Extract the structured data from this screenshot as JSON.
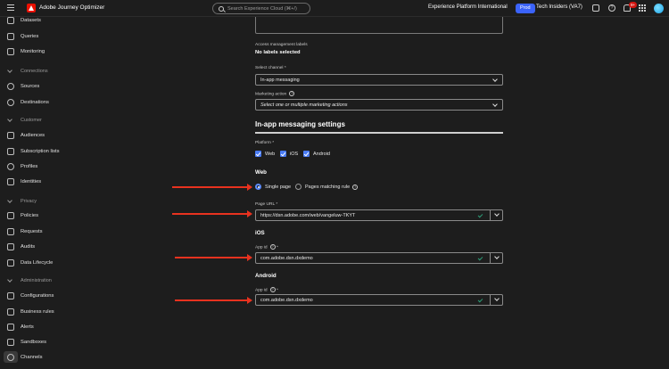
{
  "topbar": {
    "app_name": "Adobe Journey Optimizer",
    "search_placeholder": "Search Experience Cloud (⌘+/)",
    "org_name": "Experience Platform International",
    "env_badge": "Prod",
    "sandbox_name": "Tech Insiders (VA7)",
    "notification_count": "9+",
    "help_glyph": "?"
  },
  "sidebar": {
    "items_top": [
      {
        "label": "Datasets",
        "icon": "dataset-icon"
      },
      {
        "label": "Queries",
        "icon": "queries-icon"
      },
      {
        "label": "Monitoring",
        "icon": "monitoring-icon"
      }
    ],
    "sections": [
      {
        "title": "Connections",
        "items": [
          "Sources",
          "Destinations"
        ]
      },
      {
        "title": "Customer",
        "items": [
          "Audiences",
          "Subscription lists",
          "Profiles",
          "Identities"
        ]
      },
      {
        "title": "Privacy",
        "items": [
          "Policies",
          "Requests",
          "Audits",
          "Data Lifecycle"
        ]
      },
      {
        "title": "Administration",
        "items": [
          "Configurations",
          "Business rules",
          "Alerts",
          "Sandboxes",
          "Channels"
        ]
      }
    ]
  },
  "form": {
    "access_label": "Access management labels",
    "access_value": "No labels selected",
    "channel_label": "Select channel",
    "channel_value": "In-app messaging",
    "marketing_label": "Marketing action",
    "marketing_placeholder": "Select one or multiple marketing actions",
    "settings_title": "In-app messaging settings",
    "platform_label": "Platform",
    "platforms": [
      "Web",
      "iOS",
      "Android"
    ],
    "web_heading": "Web",
    "radio_single": "Single page",
    "radio_rule": "Pages matching rule",
    "page_url_label": "Page URL",
    "page_url_value": "https://dsn.adobe.com/web/vangeluw-TKYT",
    "ios_heading": "iOS",
    "ios_app_label": "App id",
    "ios_app_value": "com.adobe.dsn.dxdemo",
    "android_heading": "Android",
    "android_app_label": "App id",
    "android_app_value": "com.adobe.dsn.dxdemo",
    "required_mark": "*",
    "info_glyph": "?"
  },
  "colors": {
    "annotation_arrow": "#e8321f",
    "accent": "#3b63fb",
    "brand": "#eb1000"
  }
}
